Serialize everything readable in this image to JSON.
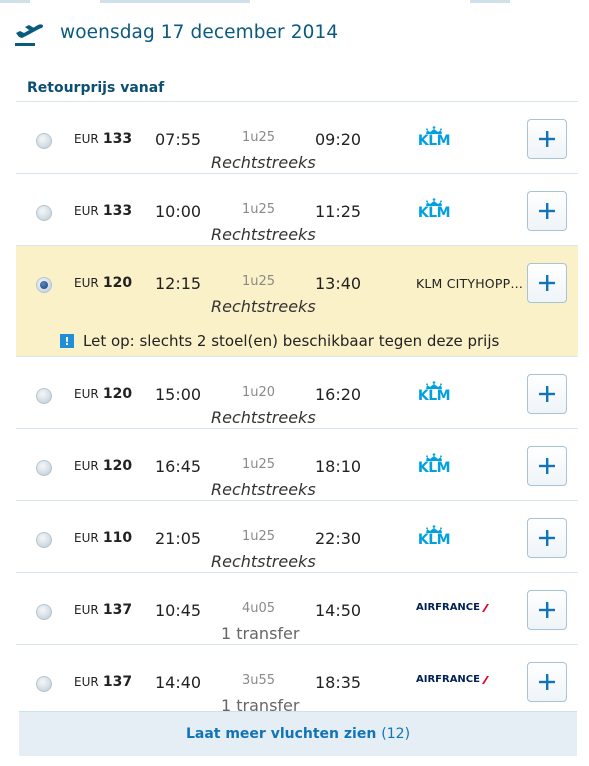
{
  "header": {
    "date": "woensdag 17 december 2014"
  },
  "subheading": "Retourprijs vanaf",
  "flights": [
    {
      "currency": "EUR",
      "price": "133",
      "depart": "07:55",
      "duration": "1u25",
      "arrive": "09:20",
      "route": "Rechtstreeks",
      "airline": "KLM",
      "selected": false
    },
    {
      "currency": "EUR",
      "price": "133",
      "depart": "10:00",
      "duration": "1u25",
      "arrive": "11:25",
      "route": "Rechtstreeks",
      "airline": "KLM",
      "selected": false
    },
    {
      "currency": "EUR",
      "price": "120",
      "depart": "12:15",
      "duration": "1u25",
      "arrive": "13:40",
      "route": "Rechtstreeks",
      "airline": "KLM CITYHOPP…",
      "selected": true,
      "warning": "Let op: slechts 2 stoel(en) beschikbaar tegen deze prijs"
    },
    {
      "currency": "EUR",
      "price": "120",
      "depart": "15:00",
      "duration": "1u20",
      "arrive": "16:20",
      "route": "Rechtstreeks",
      "airline": "KLM",
      "selected": false
    },
    {
      "currency": "EUR",
      "price": "120",
      "depart": "16:45",
      "duration": "1u25",
      "arrive": "18:10",
      "route": "Rechtstreeks",
      "airline": "KLM",
      "selected": false
    },
    {
      "currency": "EUR",
      "price": "110",
      "depart": "21:05",
      "duration": "1u25",
      "arrive": "22:30",
      "route": "Rechtstreeks",
      "airline": "KLM",
      "selected": false
    },
    {
      "currency": "EUR",
      "price": "137",
      "depart": "10:45",
      "duration": "4u05",
      "arrive": "14:50",
      "route": "1 transfer",
      "airline": "AIRFRANCE",
      "selected": false
    },
    {
      "currency": "EUR",
      "price": "137",
      "depart": "14:40",
      "duration": "3u55",
      "arrive": "18:35",
      "route": "1 transfer",
      "airline": "AIRFRANCE",
      "selected": false
    }
  ],
  "more": {
    "label": "Laat meer vluchten zien",
    "count": "(12)"
  },
  "colors": {
    "accent": "#0a5a80",
    "klm": "#00a1de",
    "airfrance": "#002157",
    "selected_bg": "#fbf1c9"
  },
  "icons": {
    "header": "plane-departure-icon",
    "add": "plus-icon",
    "warning": "info-icon"
  }
}
